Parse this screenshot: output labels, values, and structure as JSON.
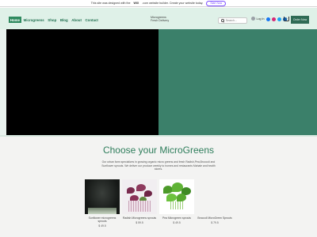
{
  "banner": {
    "text_before": "This site was designed with the",
    "brand": "WIX",
    "text_after": ".com website builder. Create your website today.",
    "button": "Start Now"
  },
  "nav": {
    "items": [
      {
        "label": "Home",
        "active": true
      },
      {
        "label": "Microgreens",
        "active": false
      },
      {
        "label": "Shop",
        "active": false
      },
      {
        "label": "Blog",
        "active": false
      },
      {
        "label": "About",
        "active": false
      },
      {
        "label": "Contact",
        "active": false
      }
    ]
  },
  "brand": {
    "line1": "Microgreens",
    "line2": "Fresh Delivery"
  },
  "search": {
    "placeholder": "Search..."
  },
  "account": {
    "label": "Log In"
  },
  "cart": {
    "count": "0"
  },
  "header_cta": {
    "label": "Order Now"
  },
  "colors": {
    "accent": "#2f8a5f",
    "hero_green": "#3b806a",
    "header_bg": "#dff1e8",
    "title": "#2e7d5b"
  },
  "section": {
    "title": "Choose your MicroGreens",
    "description": "Our urban farm specializes in growing organic micro greens and fresh Radish,Pea,Broccoli and Sunflower sprouts. We deliver our produce weekly to homes and restaurants Mahale and health stores."
  },
  "products": [
    {
      "name": "Sunflower microgreens sprouts",
      "price": "$ 49.5"
    },
    {
      "name": "Radish Microgreens sprouts",
      "price": "$ 59.5"
    },
    {
      "name": "Pea Microgreen sprouts",
      "price": "$ 49.5"
    },
    {
      "name": "Broccoli MicroGreen Sprouts",
      "price": "$ 79.5"
    }
  ]
}
